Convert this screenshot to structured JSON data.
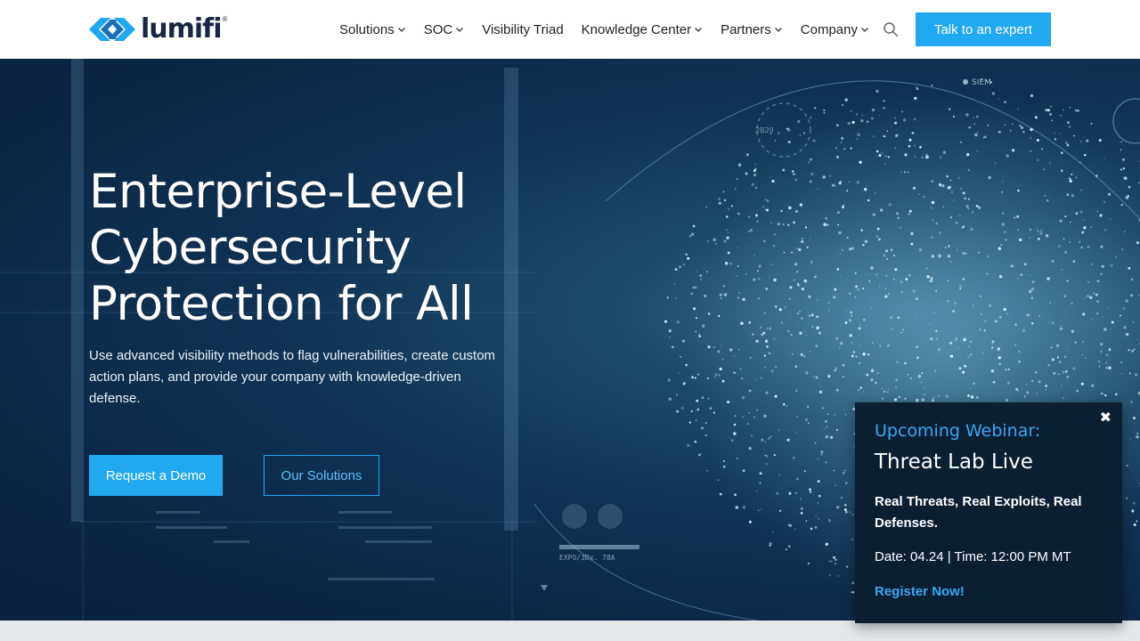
{
  "brand": {
    "name": "lumifi",
    "registered": "®",
    "colors": {
      "primary": "#20a8f0",
      "dark": "#1a2744",
      "hero_bg": "#0b2644"
    }
  },
  "nav": {
    "items": [
      {
        "label": "Solutions",
        "has_dropdown": true
      },
      {
        "label": "SOC",
        "has_dropdown": true
      },
      {
        "label": "Visibility Triad",
        "has_dropdown": false
      },
      {
        "label": "Knowledge Center",
        "has_dropdown": true
      },
      {
        "label": "Partners",
        "has_dropdown": true
      },
      {
        "label": "Company",
        "has_dropdown": true
      }
    ],
    "search_icon": "search-icon",
    "cta_label": "Talk to an expert"
  },
  "hero": {
    "title_lines": [
      "Enterprise-Level",
      "Cybersecurity",
      "Protection for All"
    ],
    "description": "Use advanced visibility methods to flag vulnerabilities, create custom action plans, and provide your company with knowledge-driven defense.",
    "primary_button": "Request a Demo",
    "secondary_button": "Our Solutions",
    "bg_labels": {
      "siem": "SIEM",
      "code": "2B29",
      "expo": "EXPO/3Dx. 78A"
    }
  },
  "popup": {
    "close_glyph": "✖",
    "label": "Upcoming Webinar:",
    "title": "Threat Lab Live",
    "subtitle": "Real Threats, Real Exploits, Real Defenses.",
    "date_line": "Date: 04.24 | Time: 12:00 PM MT",
    "link": "Register Now!"
  }
}
